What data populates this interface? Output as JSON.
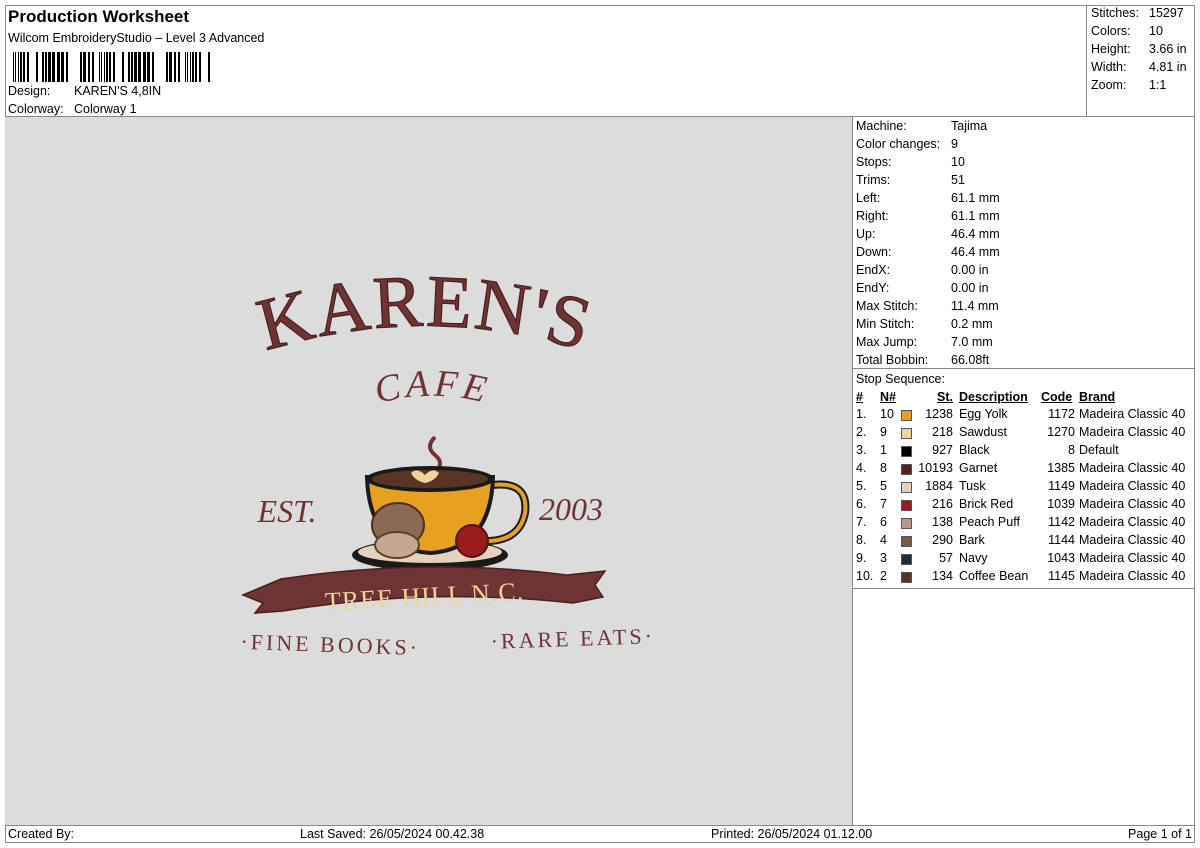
{
  "header": {
    "title": "Production Worksheet",
    "subtitle": "Wilcom EmbroideryStudio – Level 3 Advanced",
    "design_label": "Design:",
    "design_value": "KAREN'S 4,8IN",
    "colorway_label": "Colorway:",
    "colorway_value": "Colorway 1"
  },
  "summary": {
    "stitches_label": "Stitches:",
    "stitches_value": "15297",
    "colors_label": "Colors:",
    "colors_value": "10",
    "height_label": "Height:",
    "height_value": "3.66 in",
    "width_label": "Width:",
    "width_value": "4.81 in",
    "zoom_label": "Zoom:",
    "zoom_value": "1:1"
  },
  "details": [
    {
      "label": "Machine:",
      "value": "Tajima"
    },
    {
      "label": "Color changes:",
      "value": "9"
    },
    {
      "label": "Stops:",
      "value": "10"
    },
    {
      "label": "Trims:",
      "value": "51"
    },
    {
      "label": "Left:",
      "value": "61.1 mm"
    },
    {
      "label": "Right:",
      "value": "61.1 mm"
    },
    {
      "label": "Up:",
      "value": "46.4 mm"
    },
    {
      "label": "Down:",
      "value": "46.4 mm"
    },
    {
      "label": "EndX:",
      "value": "0.00 in"
    },
    {
      "label": "EndY:",
      "value": "0.00 in"
    },
    {
      "label": "Max Stitch:",
      "value": "11.4 mm"
    },
    {
      "label": "Min Stitch:",
      "value": "0.2 mm"
    },
    {
      "label": "Max Jump:",
      "value": "7.0 mm"
    },
    {
      "label": "Total Bobbin:",
      "value": "66.08ft"
    }
  ],
  "stop_sequence": {
    "title": "Stop Sequence:",
    "headers": {
      "num": "#",
      "n": "N#",
      "st": "St.",
      "desc": "Description",
      "code": "Code",
      "brand": "Brand"
    },
    "rows": [
      {
        "idx": "1.",
        "n": "10",
        "color": "#e8a020",
        "st": "1238",
        "desc": "Egg Yolk",
        "code": "1172",
        "brand": "Madeira Classic 40"
      },
      {
        "idx": "2.",
        "n": "9",
        "color": "#ecd49a",
        "st": "218",
        "desc": "Sawdust",
        "code": "1270",
        "brand": "Madeira Classic 40"
      },
      {
        "idx": "3.",
        "n": "1",
        "color": "#000000",
        "st": "927",
        "desc": "Black",
        "code": "8",
        "brand": "Default"
      },
      {
        "idx": "4.",
        "n": "8",
        "color": "#5a1d1d",
        "st": "10193",
        "desc": "Garnet",
        "code": "1385",
        "brand": "Madeira Classic 40"
      },
      {
        "idx": "5.",
        "n": "5",
        "color": "#e4d2bc",
        "st": "1884",
        "desc": "Tusk",
        "code": "1149",
        "brand": "Madeira Classic 40"
      },
      {
        "idx": "6.",
        "n": "7",
        "color": "#9b1c1c",
        "st": "216",
        "desc": "Brick Red",
        "code": "1039",
        "brand": "Madeira Classic 40"
      },
      {
        "idx": "7.",
        "n": "6",
        "color": "#b89888",
        "st": "138",
        "desc": "Peach Puff",
        "code": "1142",
        "brand": "Madeira Classic 40"
      },
      {
        "idx": "8.",
        "n": "4",
        "color": "#7a5a40",
        "st": "290",
        "desc": "Bark",
        "code": "1144",
        "brand": "Madeira Classic 40"
      },
      {
        "idx": "9.",
        "n": "3",
        "color": "#1e2a3a",
        "st": "57",
        "desc": "Navy",
        "code": "1043",
        "brand": "Madeira Classic 40"
      },
      {
        "idx": "10.",
        "n": "2",
        "color": "#5a3424",
        "st": "134",
        "desc": "Coffee Bean",
        "code": "1145",
        "brand": "Madeira Classic 40"
      }
    ]
  },
  "design_art": {
    "line1": "KAREN'S",
    "line2": "CAFE",
    "est": "EST.",
    "year": "2003",
    "banner": "TREE HILL N.C.",
    "tagline_left": "·FINE BOOKS·",
    "tagline_right": "·RARE EATS·"
  },
  "footer": {
    "created": "Created By:",
    "saved": "Last Saved: 26/05/2024 00.42.38",
    "printed": "Printed: 26/05/2024 01.12.00",
    "page": "Page 1 of 1"
  }
}
